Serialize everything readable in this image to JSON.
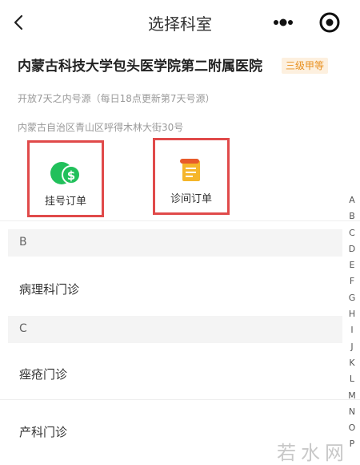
{
  "nav": {
    "title": "选择科室"
  },
  "hospital": {
    "name": "内蒙古科技大学包头医学院第二附属医院",
    "level": "三级甲等",
    "rule": "开放7天之内号源（每日18点更新第7天号源）",
    "address": "内蒙古自治区青山区呼得木林大街30号"
  },
  "entries": [
    {
      "label": "挂号订单",
      "icon": "green-coin-dollar-icon",
      "color": "#21c05b"
    },
    {
      "label": "诊间订单",
      "icon": "orange-scroll-icon",
      "color": "#f0a020"
    }
  ],
  "departments": [
    {
      "group": "B",
      "items": [
        "病理科门诊"
      ]
    },
    {
      "group": "C",
      "items": [
        "痤疮门诊",
        "产科门诊"
      ]
    }
  ],
  "index": [
    "A",
    "B",
    "C",
    "D",
    "E",
    "F",
    "G",
    "H",
    "I",
    "J",
    "K",
    "L",
    "M",
    "N",
    "O",
    "P"
  ],
  "watermark": "若水网",
  "colors": {
    "highlight_border": "#e04a4a",
    "badge_text": "#e8901f",
    "badge_bg": "#fdf0df"
  }
}
